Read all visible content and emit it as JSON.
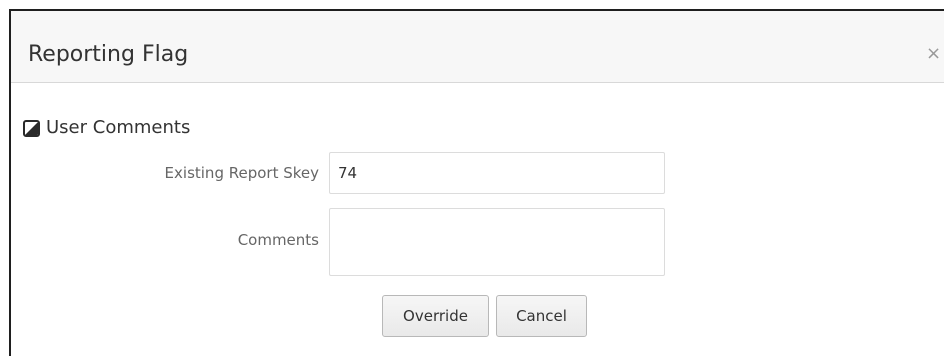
{
  "dialog": {
    "title": "Reporting Flag",
    "close_label": "×"
  },
  "section": {
    "label": "User Comments",
    "icon": "collapse-icon"
  },
  "form": {
    "existing_report_skey_label": "Existing Report Skey",
    "existing_report_skey_value": "74",
    "comments_label": "Comments",
    "comments_value": ""
  },
  "actions": {
    "override_label": "Override",
    "cancel_label": "Cancel"
  }
}
